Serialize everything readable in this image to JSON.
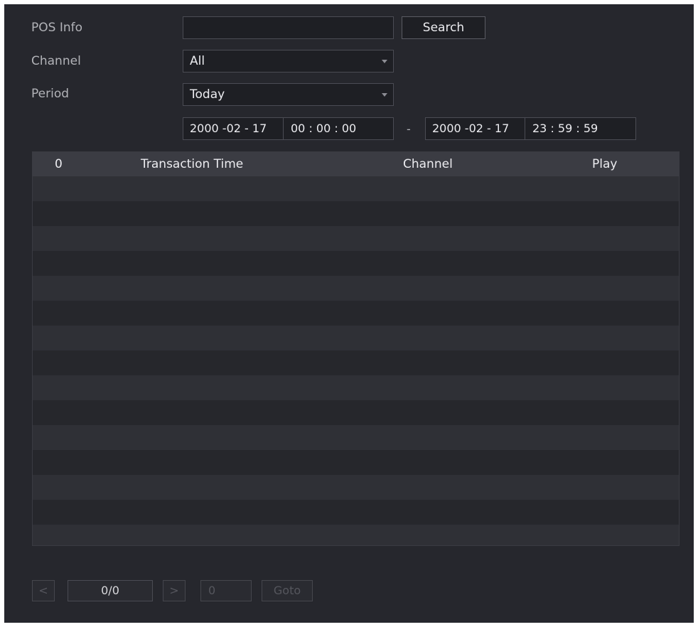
{
  "form": {
    "pos_info_label": "POS Info",
    "pos_info_value": "",
    "search_label": "Search",
    "channel_label": "Channel",
    "channel_value": "All",
    "period_label": "Period",
    "period_value": "Today",
    "start_date": "2000 -02 - 17",
    "start_time": "00 : 00 : 00",
    "range_separator": "-",
    "end_date": "2000 -02 - 17",
    "end_time": "23 : 59 : 59"
  },
  "table": {
    "columns": [
      "0",
      "Transaction Time",
      "Channel",
      "Play"
    ],
    "row_count": 15
  },
  "pagination": {
    "prev_label": "<",
    "page_indicator": "0/0",
    "next_label": ">",
    "goto_value": "0",
    "goto_label": "Goto"
  },
  "colors": {
    "background": "#26272d",
    "field_bg": "#1e1f24",
    "header_bg": "#3b3c43",
    "row_even": "#2f3036",
    "row_odd": "#26272c"
  }
}
